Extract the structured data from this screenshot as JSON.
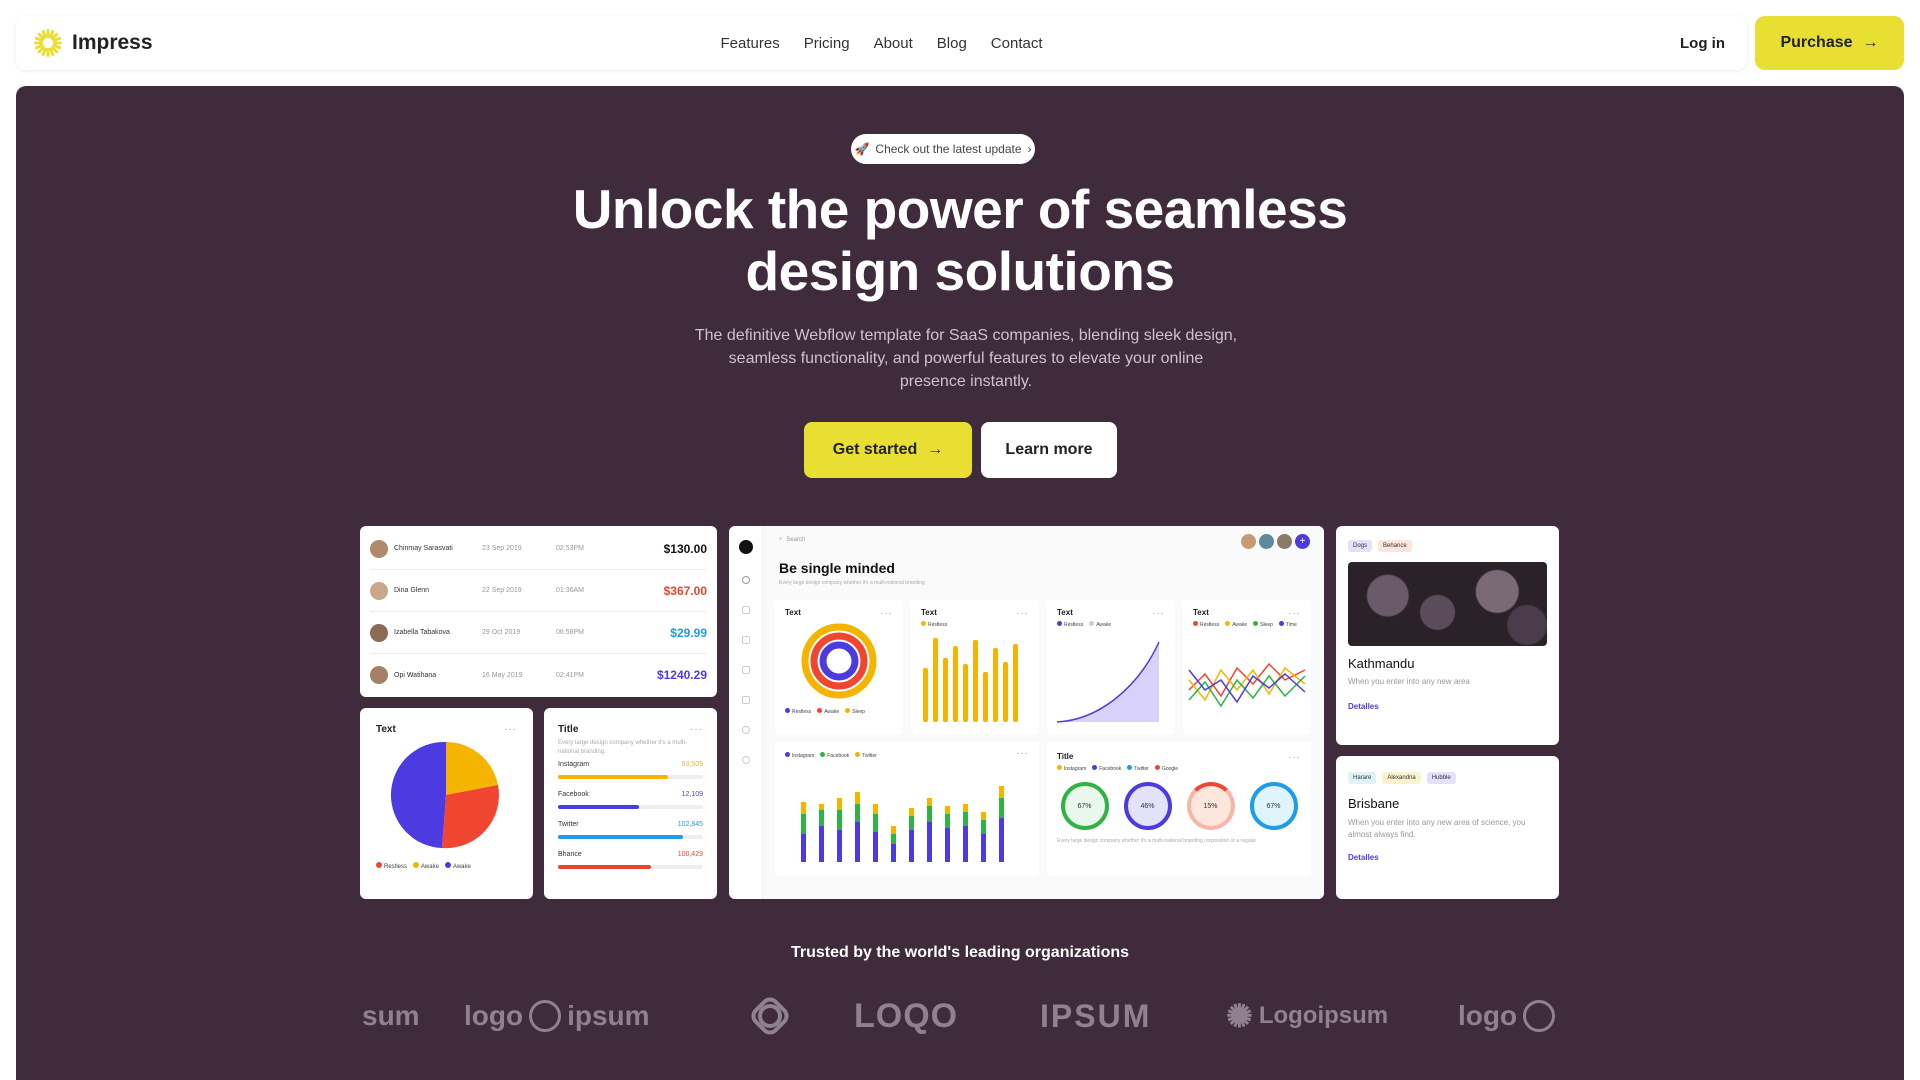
{
  "nav": {
    "brand": "Impress",
    "links": [
      "Features",
      "Pricing",
      "About",
      "Blog",
      "Contact"
    ],
    "login": "Log in",
    "purchase": "Purchase"
  },
  "hero": {
    "pill": "Check out the latest update",
    "title_line1": "Unlock the power of seamless",
    "title_line2": "design solutions",
    "subtitle": "The definitive Webflow template for SaaS companies, blending sleek design, seamless functionality, and powerful features to elevate your online presence instantly.",
    "cta_primary": "Get started",
    "cta_secondary": "Learn more"
  },
  "transactions": [
    {
      "name": "Chinmay Sarasvati",
      "date": "23 Sep 2019",
      "time": "02:53PM",
      "amount": "$130.00",
      "color": "#111111"
    },
    {
      "name": "Dina Glenn",
      "date": "22 Sep 2019",
      "time": "01:36AM",
      "amount": "$367.00",
      "color": "#e8452b"
    },
    {
      "name": "Izabella Tabakova",
      "date": "29 Oct 2019",
      "time": "06:58PM",
      "amount": "$29.99",
      "color": "#1e9be9"
    },
    {
      "name": "Opi Watihana",
      "date": "16 May 2019",
      "time": "02:41PM",
      "amount": "$1240.29",
      "color": "#4b3be0"
    }
  ],
  "pie_card": {
    "title": "Text",
    "legend": [
      "Restless",
      "Awake",
      "Awake"
    ]
  },
  "social_card": {
    "title": "Title",
    "desc": "Every large design company whether it's a multi-national branding.",
    "rows": [
      {
        "label": "Instagram",
        "value": "93,509",
        "fraction": 0.76,
        "color": "#f5b400"
      },
      {
        "label": "Facebook",
        "value": "12,109",
        "fraction": 0.56,
        "color": "#4b3be0"
      },
      {
        "label": "Twitter",
        "value": "102,845",
        "fraction": 0.86,
        "color": "#1e9be9"
      },
      {
        "label": "Bhance",
        "value": "100,429",
        "fraction": 0.64,
        "color": "#e8452b"
      }
    ]
  },
  "dashboard": {
    "search": "Search",
    "heading": "Be single minded",
    "desc": "Every large design company whether it's a multi-national branding",
    "card_titles": [
      "Text",
      "Text",
      "Text",
      "Text"
    ],
    "donut_legend": [
      "Restless",
      "Awake",
      "Sleep"
    ],
    "bar_legend": [
      "Restless"
    ],
    "area_legend": [
      "Restless",
      "Awake"
    ],
    "line_legend": [
      "Restless",
      "Awake",
      "Sleep",
      "Time"
    ],
    "bottom_legend": [
      "Instagram",
      "Facebook",
      "Twitter"
    ],
    "circles_title": "Title",
    "circles_legend": [
      "Instagram",
      "Facebook",
      "Twitter",
      "Google"
    ],
    "circles": [
      "67%",
      "46%",
      "15%",
      "67%"
    ],
    "circles_desc": "Every large design company whether it's a multi-national branding corporation or a regular"
  },
  "place_cards": [
    {
      "tags": [
        "Dogs",
        "Behance"
      ],
      "title": "Kathmandu",
      "desc": "When you enter into any new area",
      "link": "Detalles"
    },
    {
      "tags": [
        "Harare",
        "Alexandria",
        "Hubble"
      ],
      "title": "Brisbane",
      "desc": "When you enter into any new area of science, you almost always find.",
      "link": "Detalles"
    }
  ],
  "trusted": "Trusted by the world's leading organizations",
  "logos": [
    "sum",
    "logo",
    "ipsum",
    "LOQO",
    "IPSUM",
    "Logoipsum",
    "logo"
  ],
  "colors": {
    "accent": "#e8df32",
    "hero_bg": "#3f2b3b",
    "purple": "#4b3be0",
    "red": "#e8452b",
    "yellow": "#f5b400",
    "blue": "#1e9be9",
    "green": "#2fb344"
  }
}
